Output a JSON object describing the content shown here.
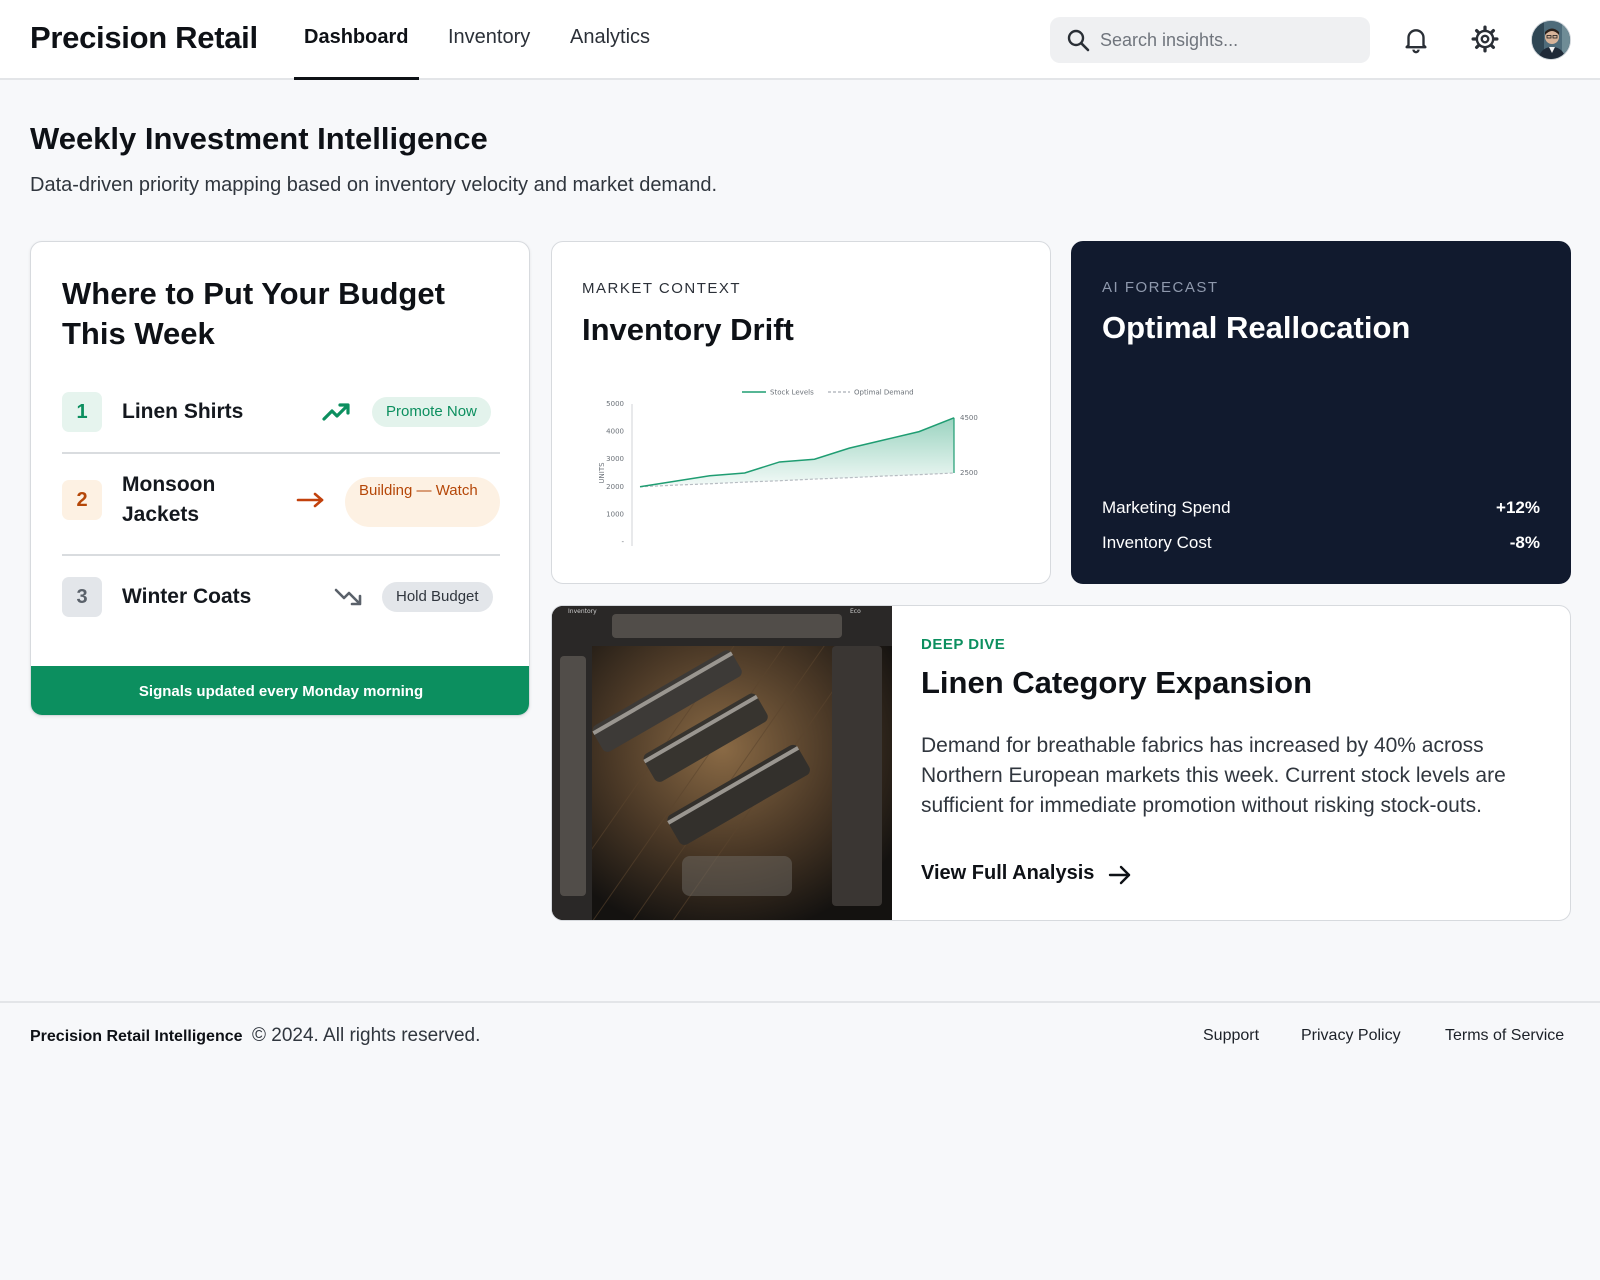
{
  "header": {
    "brand": "Precision Retail",
    "tabs": [
      {
        "label": "Dashboard",
        "active": true
      },
      {
        "label": "Inventory",
        "active": false
      },
      {
        "label": "Analytics",
        "active": false
      }
    ],
    "search_placeholder": "Search insights...",
    "icons": [
      "search-icon",
      "bell-icon",
      "gear-icon",
      "avatar"
    ]
  },
  "page": {
    "title": "Weekly Investment Intelligence",
    "subtitle": "Data-driven priority mapping based on inventory velocity and market demand."
  },
  "budget": {
    "title": "Where to Put Your Budget This Week",
    "items": [
      {
        "rank": "1",
        "name": "Linen Shirts",
        "trend": "trending-up-icon",
        "status": "Promote Now",
        "status_color": "#0c8f5f"
      },
      {
        "rank": "2",
        "name": "Monsoon Jackets",
        "trend": "arrow-right-icon",
        "status": "Building — Watch",
        "status_color": "#b54708"
      },
      {
        "rank": "3",
        "name": "Winter Coats",
        "trend": "trending-down-icon",
        "status": "Hold Budget",
        "status_color": "#3d434b"
      }
    ],
    "footer": "Signals updated every Monday morning"
  },
  "drift": {
    "eyebrow": "MARKET CONTEXT",
    "title": "Inventory Drift"
  },
  "chart_data": {
    "type": "area",
    "title": "",
    "xlabel": "",
    "ylabel": "UNITS",
    "legend": [
      "Stock Levels",
      "Optimal Demand"
    ],
    "legend_position": "top",
    "y_ticks": [
      "5000",
      "4000",
      "3000",
      "2000",
      "1000",
      "0"
    ],
    "ylim": [
      0,
      5000
    ],
    "x": [
      0,
      1,
      2,
      3,
      4,
      5,
      6,
      7,
      8,
      9
    ],
    "series": [
      {
        "name": "Stock Levels",
        "values": [
          2000,
          2200,
          2400,
          2500,
          2900,
          3000,
          3400,
          3700,
          4000,
          4500
        ],
        "color": "#1f9d72",
        "end_label": "4500"
      },
      {
        "name": "Optimal Demand",
        "values": [
          2000,
          2060,
          2110,
          2170,
          2220,
          2280,
          2330,
          2390,
          2440,
          2500
        ],
        "color": "#b7bcc2",
        "dashed": true,
        "end_label": "2500"
      }
    ]
  },
  "forecast": {
    "eyebrow": "AI FORECAST",
    "title": "Optimal Reallocation",
    "rows": [
      {
        "label": "Marketing Spend",
        "value": "+12%"
      },
      {
        "label": "Inventory Cost",
        "value": "-8%"
      }
    ]
  },
  "deep_dive": {
    "eyebrow": "DEEP DIVE",
    "title": "Linen Category Expansion",
    "body": "Demand for breathable fabrics has increased by 40% across Northern European markets this week. Current stock levels are sufficient for immediate promotion without risking stock-outs.",
    "link": "View Full Analysis",
    "image": "store-racks-aerial-photo"
  },
  "footer": {
    "brand": "Precision Retail Intelligence",
    "copyright": "© 2024. All rights reserved.",
    "links": [
      "Support",
      "Privacy Policy",
      "Terms of Service"
    ]
  },
  "colors": {
    "accent_green": "#0c8f5f",
    "dark_navy": "#111a2e",
    "orange": "#b54708"
  }
}
